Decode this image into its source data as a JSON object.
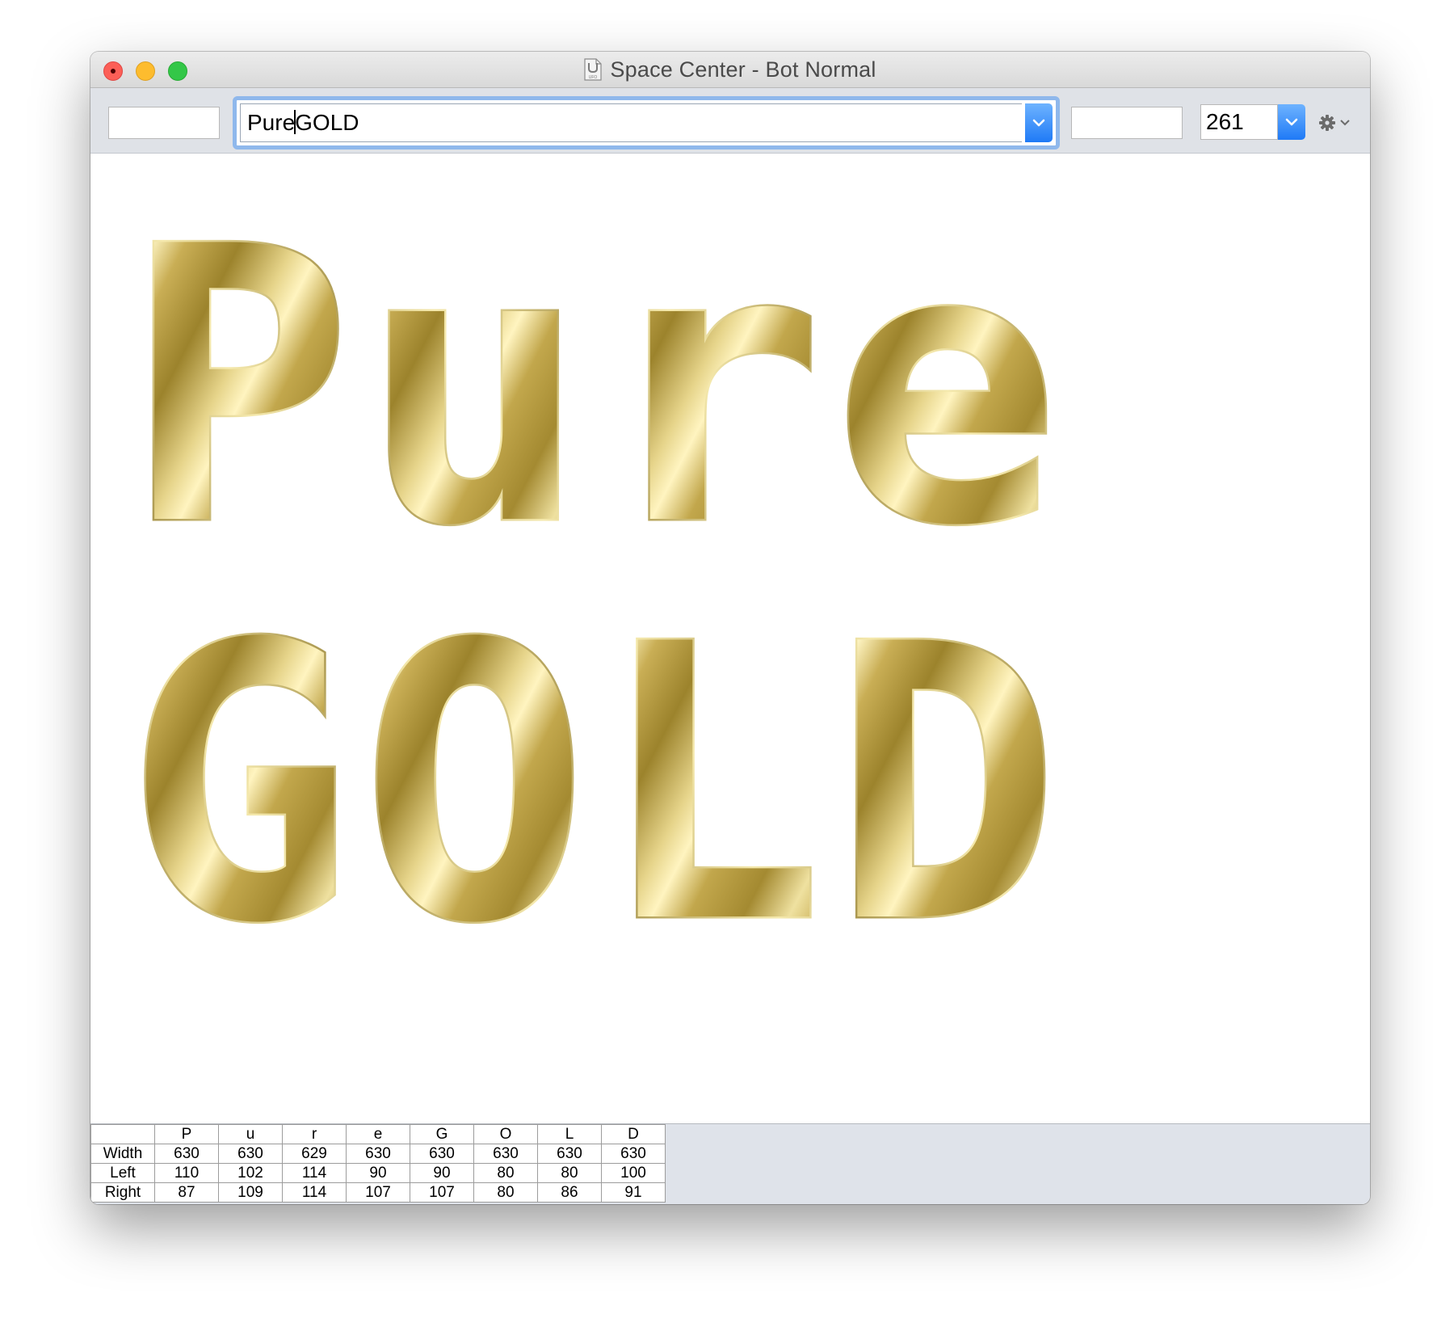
{
  "window": {
    "title": "Space Center - Bot Normal",
    "doc_icon_label": "UFO"
  },
  "toolbar": {
    "left_field_value": "",
    "text_value_before_cursor": "Pure",
    "text_value_after_cursor": "GOLD",
    "right_field_value": "",
    "size_value": "261",
    "accent_color": "#2a84f8",
    "focus_ring_color": "#8fb8ec"
  },
  "preview": {
    "lines": [
      [
        "P",
        "u",
        "r",
        "e"
      ],
      [
        "G",
        "O",
        "L",
        "D"
      ]
    ],
    "fill_style": "gold gradient",
    "gold_colors": [
      "#b39a3c",
      "#fff6c4",
      "#c8ae52",
      "#8f7a2a"
    ]
  },
  "metrics": {
    "row_headers": [
      "Width",
      "Left",
      "Right"
    ],
    "glyphs": [
      "P",
      "u",
      "r",
      "e",
      "G",
      "O",
      "L",
      "D"
    ],
    "width": [
      "630",
      "630",
      "629",
      "630",
      "630",
      "630",
      "630",
      "630"
    ],
    "left": [
      "110",
      "102",
      "114",
      "90",
      "90",
      "80",
      "80",
      "100"
    ],
    "right": [
      "87",
      "109",
      "114",
      "107",
      "107",
      "80",
      "86",
      "91"
    ]
  }
}
